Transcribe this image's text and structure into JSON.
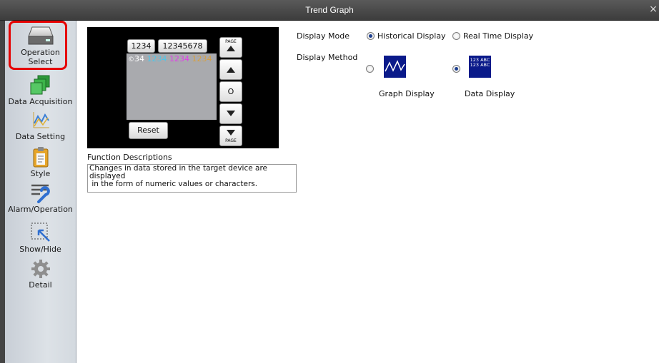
{
  "window": {
    "title": "Trend Graph",
    "close_glyph": "×"
  },
  "sidebar": {
    "items": [
      {
        "label_1": "Operation",
        "label_2": "Select",
        "icon": "disk-drive-icon",
        "selected": true
      },
      {
        "label": "Data Acquisition",
        "icon": "stacked-squares-icon"
      },
      {
        "label": "Data Setting",
        "icon": "graph-line-icon"
      },
      {
        "label": "Style",
        "icon": "clipboard-icon"
      },
      {
        "label": "Alarm/Operation",
        "icon": "wrench-lines-icon"
      },
      {
        "label": "Show/Hide",
        "icon": "cursor-box-icon"
      },
      {
        "label": "Detail",
        "icon": "gear-icon"
      }
    ]
  },
  "preview": {
    "field1": "1234",
    "field2": "12345678",
    "data_row": [
      "34",
      "1234",
      "1234",
      "1234"
    ],
    "data_row_prefix": "©",
    "data_colors": [
      "#ffffff",
      "#4fc6e8",
      "#e040e8",
      "#d8a040"
    ],
    "reset_label": "Reset",
    "page_label": "PAGE",
    "center_label": "O"
  },
  "function_descriptions": {
    "label": "Function Descriptions",
    "text_line1": "Changes in data stored in the target device are displayed",
    "text_line2": " in the form of numeric values or characters."
  },
  "display_mode": {
    "label": "Display Mode",
    "options": [
      {
        "label": "Historical Display",
        "selected": true
      },
      {
        "label": "Real Time Display",
        "selected": false
      }
    ]
  },
  "display_method": {
    "label": "Display Method",
    "options": [
      {
        "label": "Graph Display",
        "selected": false,
        "thumb": "wave-thumbnail"
      },
      {
        "label": "Data Display",
        "selected": true,
        "thumb": "data-thumbnail",
        "thumb_text_1": "123 ABC",
        "thumb_text_2": "123 ABC"
      }
    ]
  },
  "colors": {
    "accent_red": "#e60000",
    "thumb_blue": "#0a1a8a",
    "radio_dot": "#1d3f8f"
  }
}
